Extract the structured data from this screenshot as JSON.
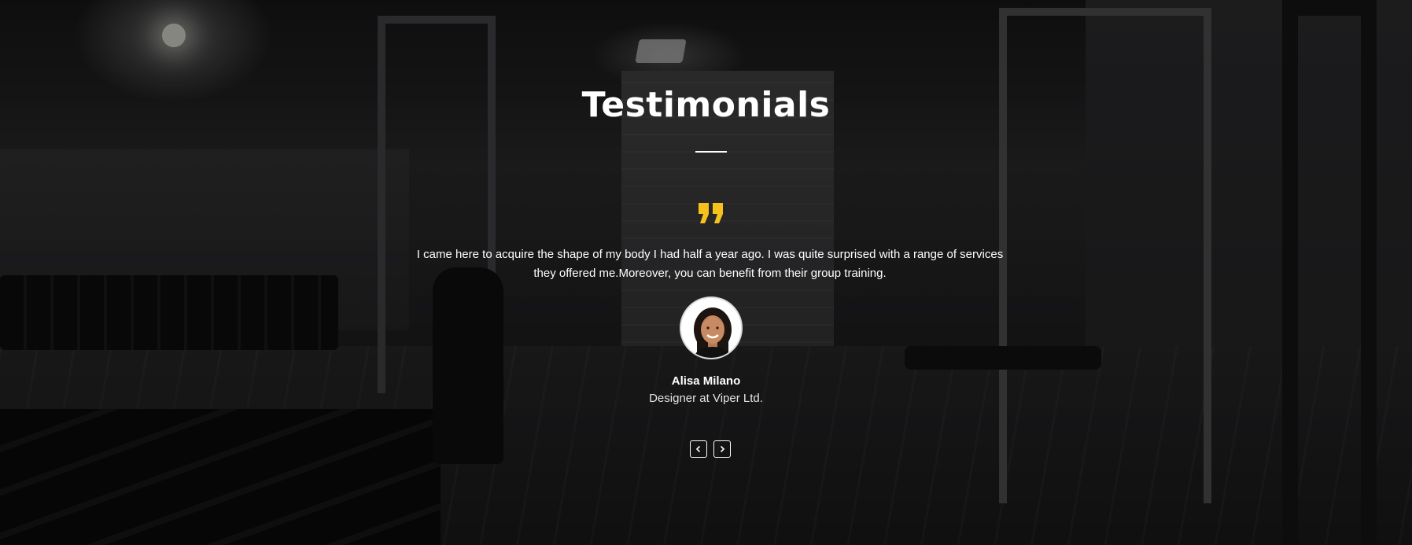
{
  "section": {
    "title": "Testimonials"
  },
  "testimonial": {
    "quote_icon": "quote-icon",
    "quote": "I came here to acquire the shape of my body I had half a year ago. I was quite surprised with a range of services they offered me.Moreover, you can benefit from their group training.",
    "author_name": "Alisa Milano",
    "author_role": "Designer at Viper Ltd."
  },
  "navigation": {
    "prev_icon": "chevron-left-icon",
    "next_icon": "chevron-right-icon"
  },
  "colors": {
    "accent": "#f5c21b",
    "text": "#ffffff",
    "overlay": "rgba(0,0,0,0.45)"
  }
}
